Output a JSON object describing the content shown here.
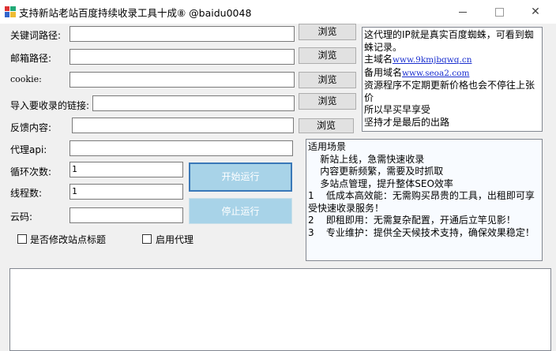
{
  "window": {
    "title": "支持新站老站百度持续收录工具十成⑧  @baidu0048",
    "minimize_label": "—",
    "close_label": "✕"
  },
  "form": {
    "keyword_path_label": "关键词路径:",
    "email_path_label": "邮箱路径:",
    "cookie_label": "cookie:",
    "links_label": "导入要收录的链接:",
    "feedback_label": "反馈内容:",
    "proxy_api_label": "代理api:",
    "loop_count_label": "循环次数:",
    "loop_count_value": "1",
    "thread_count_label": "线程数:",
    "thread_count_value": "1",
    "captcha_label": "云码:",
    "browse_label": "浏览"
  },
  "actions": {
    "start_label": "开始运行",
    "stop_label": "停止运行"
  },
  "options": {
    "modify_title_label": "是否修改站点标题",
    "enable_proxy_label": "启用代理"
  },
  "info": {
    "line1": "这代理的IP就是真实百度蜘蛛，可看到蜘蛛记录。",
    "main_domain_prefix": "主域名",
    "main_domain": "www.9kmjbqwq.cn",
    "backup_domain_prefix": "备用域名",
    "backup_domain": "www.seoa2.com",
    "line4": "资源程序不定期更新价格也会不停往上张价",
    "line5": "所以早买早享受",
    "line6": "坚持才是最后的出路"
  },
  "scenario": {
    "title": "适用场景",
    "s1": "    新站上线，急需快速收录",
    "s2": "    内容更新频繁，需要及时抓取",
    "s3": "    多站点管理，提升整体SEO效率",
    "p1": "1    低成本高效能：无需购买昂贵的工具，出租即可享受快速收录服务！",
    "p2": "2    即租即用：无需复杂配置，开通后立竿见影！",
    "p3": "3    专业维护：提供全天候技术支持，确保效果稳定！"
  },
  "colors": {
    "start_bg": "#a8d3e8",
    "start_border": "#3a78b8",
    "stop_bg": "#a8d3e8",
    "link": "#1a2fcf"
  }
}
